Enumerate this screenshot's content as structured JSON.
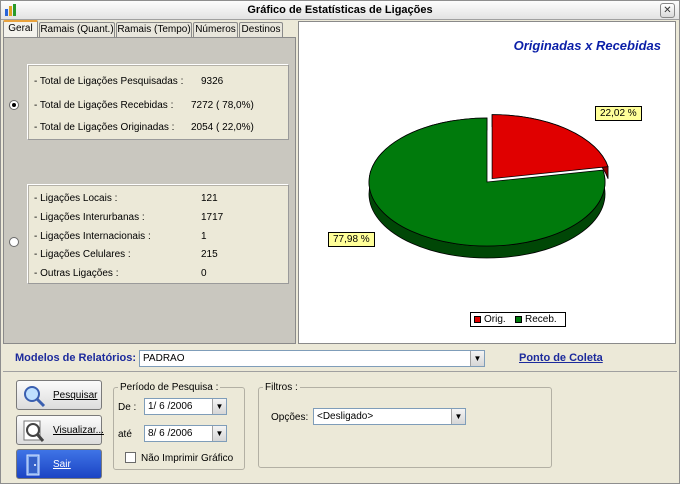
{
  "window": {
    "title": "Gráfico de Estatísticas de Ligações",
    "close_glyph": "✕"
  },
  "tabs": [
    {
      "label": "Geral",
      "active": true
    },
    {
      "label": "Ramais (Quant.)"
    },
    {
      "label": "Ramais (Tempo)"
    },
    {
      "label": "Números"
    },
    {
      "label": "Destinos"
    }
  ],
  "summary": {
    "selected": true,
    "rows": [
      {
        "label": "- Total de Ligações Pesquisadas :",
        "value": "9326"
      },
      {
        "label": "- Total de Ligações Recebidas :",
        "value": "7272 ( 78,0%)"
      },
      {
        "label": "- Total de Ligações Originadas :",
        "value": "2054 ( 22,0%)"
      }
    ]
  },
  "types": {
    "selected": false,
    "rows": [
      {
        "label": "- Ligações Locais :",
        "value": "121"
      },
      {
        "label": "- Ligações Interurbanas :",
        "value": "1717"
      },
      {
        "label": "- Ligações Internacionais :",
        "value": "1"
      },
      {
        "label": "- Ligações Celulares :",
        "value": "215"
      },
      {
        "label": "- Outras Ligações :",
        "value": "0"
      }
    ]
  },
  "chart_data": {
    "type": "pie",
    "title": "Originadas x Recebidas",
    "slices": [
      {
        "legend": "Orig.",
        "value": 22.02,
        "label": "22,02 %",
        "color": "#e00000"
      },
      {
        "legend": "Receb.",
        "value": 77.98,
        "label": "77,98 %",
        "color": "#007a0c"
      }
    ],
    "legend_position": "bottom"
  },
  "models": {
    "label": "Modelos de Relatórios:",
    "value": "PADRAO",
    "link": "Ponto de Coleta"
  },
  "buttons": {
    "search": "Pesquisar",
    "view": "Visualizar...",
    "exit": "Sair"
  },
  "period": {
    "legend": "Período de Pesquisa :",
    "from_label": "De :",
    "from_value": "1/ 6 /2006",
    "to_label": "até",
    "to_value": "8/ 6 /2006",
    "no_print_label": "Não Imprimir  Gráfico"
  },
  "filters": {
    "legend": "Filtros :",
    "options_label": "Opções:",
    "options_value": "<Desligado>"
  }
}
